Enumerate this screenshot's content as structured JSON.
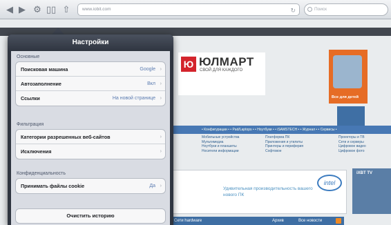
{
  "toolbar": {
    "url": "www.iobit.com",
    "search_placeholder": "Поиск"
  },
  "page": {
    "logo_mark": "Ю",
    "logo_title": "ЮЛМАРТ",
    "logo_subtitle": "СВОЙ ДЛЯ КАЖДОГО",
    "promo_label": "Все для детей",
    "category_bar": "• Конфигурации • • Pad/Laptops •  • Ноутбуки •  • iSAMSTECH •  • Журнал •  • Сервисы •",
    "col1": [
      "Мобильные устройства",
      "Мультимедиа",
      "Ноутбуки и планшеты",
      "Носители информации"
    ],
    "col2": [
      "Платформа ПК",
      "Приложения и утилиты",
      "Принтеры и периферия",
      "Софтовое"
    ],
    "col3": [
      "Проекторы и ТВ",
      "Сети и серверы",
      "Цифровое видео",
      "Цифровое фото"
    ],
    "banner_text": "Удивительная производительность вашего нового ПК",
    "intel": "intel",
    "side_title": "iXBT TV",
    "news_left": "Сети hardware",
    "news_mid": "Архив",
    "news_right": "Все новости"
  },
  "settings": {
    "title": "Настройки",
    "sections": [
      {
        "header": "Основные",
        "rows": [
          {
            "label": "Поисковая машина",
            "value": "Google"
          },
          {
            "label": "Автозаполнение",
            "value": "Вкл"
          },
          {
            "label": "Ссылки",
            "value": "На новой странице"
          }
        ]
      },
      {
        "header": "Фильтрация",
        "rows": [
          {
            "label": "Категории разрешенных веб-сайтов",
            "value": ""
          },
          {
            "label": "Исключения",
            "value": ""
          }
        ]
      },
      {
        "header": "Конфиденциальность",
        "rows": [
          {
            "label": "Принимать файлы cookie",
            "value": "Да"
          }
        ]
      }
    ],
    "clear_history": "Очистить историю"
  },
  "colors": {
    "popover_frame": "#2f3540",
    "value_blue": "#5a7bb0",
    "logo_red": "#d3242c"
  }
}
